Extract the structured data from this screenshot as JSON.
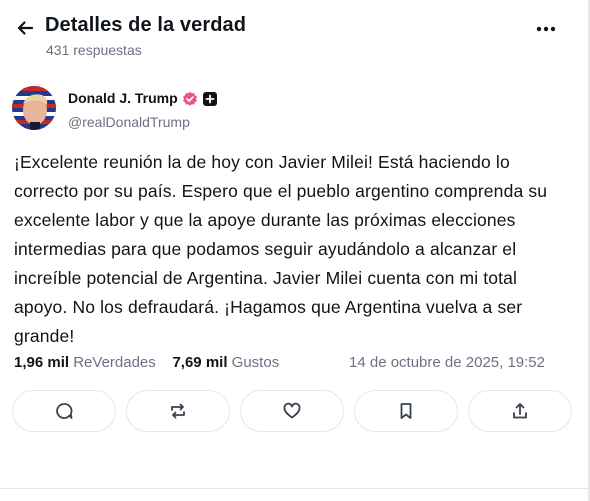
{
  "header": {
    "title": "Detalles de la verdad",
    "subtitle": "431 respuestas"
  },
  "post": {
    "author_name": "Donald J. Trump",
    "author_handle": "@realDonaldTrump",
    "text": "¡Excelente reunión la de hoy con Javier Milei! Está haciendo lo correcto por su país. Espero que el pueblo argentino comprenda su excelente labor y que la apoye durante las próximas elecciones intermedias para que podamos seguir ayudándolo a alcanzar el increíble potencial de Argentina. Javier Milei cuenta con mi total apoyo. No los defraudará. ¡Hagamos que Argentina vuelva a ser grande!",
    "retruths_count": "1,96 mil",
    "retruths_label": "ReVerdades",
    "likes_count": "7,69 mil",
    "likes_label": "Gustos",
    "date": "14 de octubre de 2025, 19:52"
  },
  "icons": {
    "back": "arrow-left-icon",
    "more": "more-horizontal-icon",
    "verified": "verified-badge-icon",
    "plus": "plus-badge-icon",
    "reply": "comment-icon",
    "retruth": "repost-icon",
    "like": "heart-icon",
    "bookmark": "bookmark-icon",
    "share": "share-icon"
  },
  "colors": {
    "text": "#0f1419",
    "muted": "#6b7280",
    "border": "#e5e7eb",
    "verified": "#f0508d"
  }
}
